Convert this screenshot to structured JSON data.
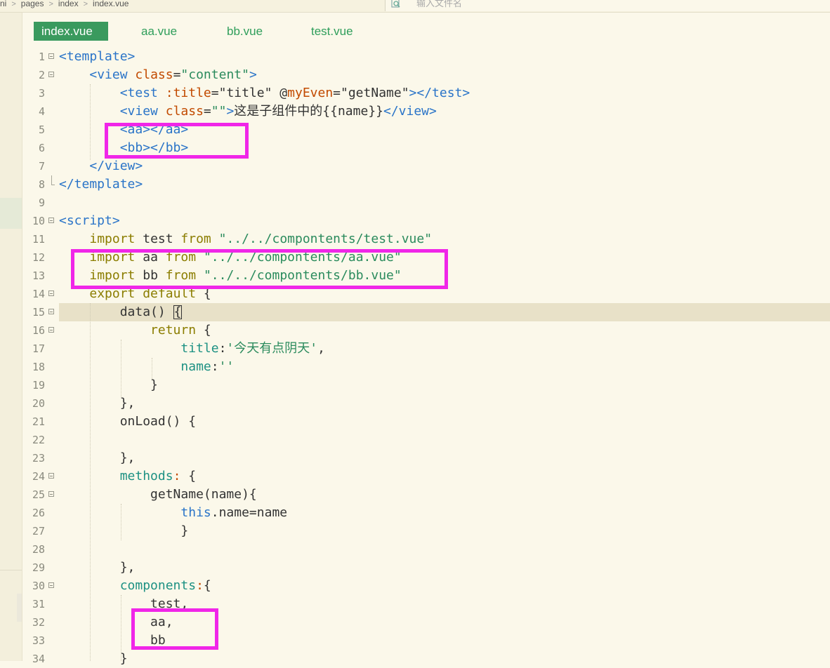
{
  "breadcrumb": [
    "ni",
    "pages",
    "index",
    "index.vue"
  ],
  "search": {
    "placeholder": "输入文件名"
  },
  "tabs": [
    {
      "label": "index.vue",
      "active": true
    },
    {
      "label": "aa.vue",
      "active": false
    },
    {
      "label": "bb.vue",
      "active": false
    },
    {
      "label": "test.vue",
      "active": false
    }
  ],
  "colors": {
    "tab_active": "#3a9a5e",
    "highlight_box": "#f026e8",
    "background": "#fbf8ea"
  },
  "code_lines": [
    {
      "n": "1",
      "fold": "open",
      "tokens": [
        [
          "t-tag",
          "<template>"
        ]
      ]
    },
    {
      "n": "2",
      "fold": "open",
      "tokens": [
        [
          "t-id",
          "    "
        ],
        [
          "t-tag",
          "<view "
        ],
        [
          "t-attr",
          "class"
        ],
        [
          "t-id",
          "="
        ],
        [
          "t-str",
          "\"content\""
        ],
        [
          "t-tag",
          ">"
        ]
      ]
    },
    {
      "n": "3",
      "fold": "",
      "tokens": [
        [
          "t-id",
          "        "
        ],
        [
          "t-tag",
          "<test "
        ],
        [
          "t-attr",
          ":title"
        ],
        [
          "t-id",
          "=\"title\" @"
        ],
        [
          "t-attr",
          "myEven"
        ],
        [
          "t-id",
          "=\"getName\""
        ],
        [
          "t-tag",
          "></test>"
        ]
      ]
    },
    {
      "n": "4",
      "fold": "",
      "tokens": [
        [
          "t-id",
          "        "
        ],
        [
          "t-tag",
          "<view "
        ],
        [
          "t-attr",
          "class"
        ],
        [
          "t-id",
          "="
        ],
        [
          "t-str",
          "\"\""
        ],
        [
          "t-tag",
          ">"
        ],
        [
          "t-id",
          "这是子组件中的{{name}}"
        ],
        [
          "t-tag",
          "</view>"
        ]
      ]
    },
    {
      "n": "5",
      "fold": "",
      "tokens": [
        [
          "t-id",
          "        "
        ],
        [
          "t-tag",
          "<aa></aa>"
        ]
      ]
    },
    {
      "n": "6",
      "fold": "",
      "tokens": [
        [
          "t-id",
          "        "
        ],
        [
          "t-tag",
          "<bb></bb>"
        ]
      ]
    },
    {
      "n": "7",
      "fold": "",
      "tokens": [
        [
          "t-id",
          "    "
        ],
        [
          "t-tag",
          "</view>"
        ]
      ]
    },
    {
      "n": "8",
      "fold": "end",
      "tokens": [
        [
          "t-tag",
          "</template>"
        ]
      ]
    },
    {
      "n": "9",
      "fold": "",
      "tokens": []
    },
    {
      "n": "10",
      "fold": "open",
      "tokens": [
        [
          "t-tag",
          "<script>"
        ]
      ]
    },
    {
      "n": "11",
      "fold": "",
      "tokens": [
        [
          "t-id",
          "    "
        ],
        [
          "t-kw",
          "import"
        ],
        [
          "t-id",
          " test "
        ],
        [
          "t-kw",
          "from"
        ],
        [
          "t-id",
          " "
        ],
        [
          "t-str",
          "\"../../compontents/test.vue\""
        ]
      ]
    },
    {
      "n": "12",
      "fold": "",
      "tokens": [
        [
          "t-id",
          "    "
        ],
        [
          "t-kw",
          "import"
        ],
        [
          "t-id",
          " aa "
        ],
        [
          "t-kw",
          "from"
        ],
        [
          "t-id",
          " "
        ],
        [
          "t-str",
          "\"../../compontents/aa.vue\""
        ]
      ]
    },
    {
      "n": "13",
      "fold": "",
      "tokens": [
        [
          "t-id",
          "    "
        ],
        [
          "t-kw",
          "import"
        ],
        [
          "t-id",
          " bb "
        ],
        [
          "t-kw",
          "from"
        ],
        [
          "t-id",
          " "
        ],
        [
          "t-str",
          "\"../../compontents/bb.vue\""
        ]
      ]
    },
    {
      "n": "14",
      "fold": "open",
      "tokens": [
        [
          "t-id",
          "    "
        ],
        [
          "t-kw",
          "export default"
        ],
        [
          "t-id",
          " {"
        ]
      ]
    },
    {
      "n": "15",
      "fold": "open",
      "highlight": true,
      "tokens": [
        [
          "t-id",
          "        data() "
        ],
        [
          "cursor",
          "{"
        ]
      ]
    },
    {
      "n": "16",
      "fold": "open",
      "tokens": [
        [
          "t-id",
          "            "
        ],
        [
          "t-kw",
          "return"
        ],
        [
          "t-id",
          " {"
        ]
      ]
    },
    {
      "n": "17",
      "fold": "",
      "tokens": [
        [
          "t-id",
          "                "
        ],
        [
          "t-teal",
          "title"
        ],
        [
          "t-id",
          ":"
        ],
        [
          "t-str",
          "'今天有点阴天'"
        ],
        [
          "t-id",
          ","
        ]
      ]
    },
    {
      "n": "18",
      "fold": "",
      "tokens": [
        [
          "t-id",
          "                "
        ],
        [
          "t-teal",
          "name"
        ],
        [
          "t-id",
          ":"
        ],
        [
          "t-str",
          "''"
        ]
      ]
    },
    {
      "n": "19",
      "fold": "",
      "tokens": [
        [
          "t-id",
          "            }"
        ]
      ]
    },
    {
      "n": "20",
      "fold": "",
      "tokens": [
        [
          "t-id",
          "        },"
        ]
      ]
    },
    {
      "n": "21",
      "fold": "",
      "tokens": [
        [
          "t-id",
          "        onLoad() {"
        ]
      ]
    },
    {
      "n": "22",
      "fold": "",
      "tokens": []
    },
    {
      "n": "23",
      "fold": "",
      "tokens": [
        [
          "t-id",
          "        },"
        ]
      ]
    },
    {
      "n": "24",
      "fold": "open",
      "tokens": [
        [
          "t-id",
          "        "
        ],
        [
          "t-teal",
          "methods"
        ],
        [
          "t-attr",
          ":"
        ],
        [
          "t-id",
          " {"
        ]
      ]
    },
    {
      "n": "25",
      "fold": "open",
      "tokens": [
        [
          "t-id",
          "            getName(name){"
        ]
      ]
    },
    {
      "n": "26",
      "fold": "",
      "tokens": [
        [
          "t-id",
          "                "
        ],
        [
          "t-blue",
          "this"
        ],
        [
          "t-id",
          ".name=name"
        ]
      ]
    },
    {
      "n": "27",
      "fold": "",
      "tokens": [
        [
          "t-id",
          "                }"
        ]
      ]
    },
    {
      "n": "28",
      "fold": "",
      "tokens": []
    },
    {
      "n": "29",
      "fold": "",
      "tokens": [
        [
          "t-id",
          "        },"
        ]
      ]
    },
    {
      "n": "30",
      "fold": "open",
      "tokens": [
        [
          "t-id",
          "        "
        ],
        [
          "t-teal",
          "components"
        ],
        [
          "t-attr",
          ":"
        ],
        [
          "t-id",
          "{"
        ]
      ]
    },
    {
      "n": "31",
      "fold": "",
      "tokens": [
        [
          "t-id",
          "            test,"
        ]
      ]
    },
    {
      "n": "32",
      "fold": "",
      "tokens": [
        [
          "t-id",
          "            aa,"
        ]
      ]
    },
    {
      "n": "33",
      "fold": "",
      "tokens": [
        [
          "t-id",
          "            bb"
        ]
      ]
    },
    {
      "n": "34",
      "fold": "",
      "tokens": [
        [
          "t-id",
          "        }"
        ]
      ]
    }
  ]
}
